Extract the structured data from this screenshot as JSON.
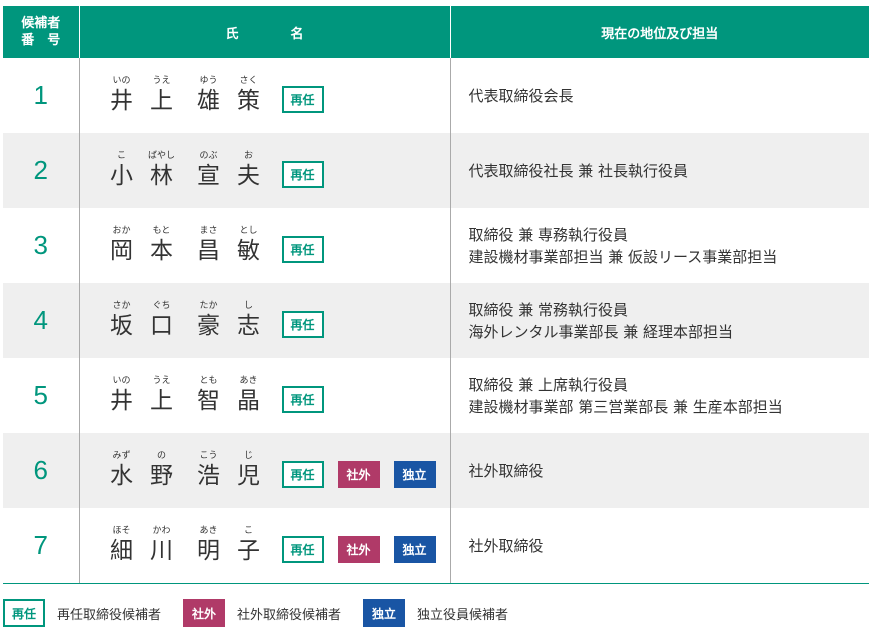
{
  "colors": {
    "accent": "#00967d",
    "outside": "#b03a68",
    "independent": "#1955a4",
    "shade": "#efefef"
  },
  "header": {
    "number_line1": "候補者",
    "number_line2": "番　号",
    "name_a": "氏",
    "name_b": "名",
    "position": "現在の地位及び担当"
  },
  "badge_labels": {
    "reelect": "再任",
    "outside": "社外",
    "independent": "独立"
  },
  "candidates": [
    {
      "number": "1",
      "name": [
        {
          "k": "井",
          "r": "いの"
        },
        {
          "k": "上",
          "r": "うえ"
        },
        {
          "k": "雄",
          "r": "ゆう"
        },
        {
          "k": "策",
          "r": "さく"
        }
      ],
      "badges": [
        "reelect"
      ],
      "position": [
        "代表取締役会長"
      ]
    },
    {
      "number": "2",
      "name": [
        {
          "k": "小",
          "r": "こ"
        },
        {
          "k": "林",
          "r": "ばやし"
        },
        {
          "k": "宣",
          "r": "のぶ"
        },
        {
          "k": "夫",
          "r": "お"
        }
      ],
      "badges": [
        "reelect"
      ],
      "position": [
        "代表取締役社長 兼 社長執行役員"
      ]
    },
    {
      "number": "3",
      "name": [
        {
          "k": "岡",
          "r": "おか"
        },
        {
          "k": "本",
          "r": "もと"
        },
        {
          "k": "昌",
          "r": "まさ"
        },
        {
          "k": "敏",
          "r": "とし"
        }
      ],
      "badges": [
        "reelect"
      ],
      "position": [
        "取締役 兼 専務執行役員",
        "建設機材事業部担当 兼 仮設リース事業部担当"
      ]
    },
    {
      "number": "4",
      "name": [
        {
          "k": "坂",
          "r": "さか"
        },
        {
          "k": "口",
          "r": "ぐち"
        },
        {
          "k": "豪",
          "r": "たか"
        },
        {
          "k": "志",
          "r": "し"
        }
      ],
      "badges": [
        "reelect"
      ],
      "position": [
        "取締役 兼 常務執行役員",
        "海外レンタル事業部長 兼 経理本部担当"
      ]
    },
    {
      "number": "5",
      "name": [
        {
          "k": "井",
          "r": "いの"
        },
        {
          "k": "上",
          "r": "うえ"
        },
        {
          "k": "智",
          "r": "とも"
        },
        {
          "k": "晶",
          "r": "あき"
        }
      ],
      "badges": [
        "reelect"
      ],
      "position": [
        "取締役 兼 上席執行役員",
        "建設機材事業部 第三営業部長 兼 生産本部担当"
      ]
    },
    {
      "number": "6",
      "name": [
        {
          "k": "水",
          "r": "みず"
        },
        {
          "k": "野",
          "r": "の"
        },
        {
          "k": "浩",
          "r": "こう"
        },
        {
          "k": "児",
          "r": "じ"
        }
      ],
      "badges": [
        "reelect",
        "outside",
        "independent"
      ],
      "position": [
        "社外取締役"
      ]
    },
    {
      "number": "7",
      "name": [
        {
          "k": "細",
          "r": "ほそ"
        },
        {
          "k": "川",
          "r": "かわ"
        },
        {
          "k": "明",
          "r": "あき"
        },
        {
          "k": "子",
          "r": "こ"
        }
      ],
      "badges": [
        "reelect",
        "outside",
        "independent"
      ],
      "position": [
        "社外取締役"
      ]
    }
  ],
  "legend": [
    {
      "type": "reelect",
      "label": "再任",
      "text": "再任取締役候補者"
    },
    {
      "type": "outside",
      "label": "社外",
      "text": "社外取締役候補者"
    },
    {
      "type": "independent",
      "label": "独立",
      "text": "独立役員候補者"
    }
  ]
}
